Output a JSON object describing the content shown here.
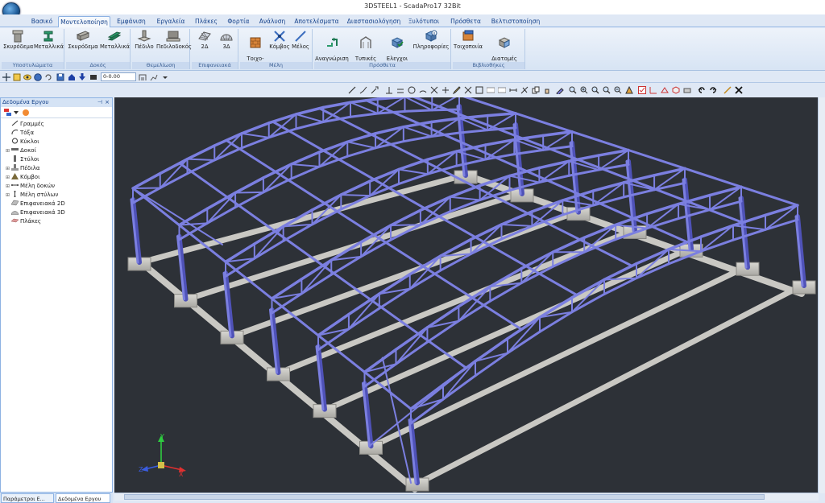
{
  "window": {
    "title": "3DSTEEL1 - ScadaPro17 32Bit"
  },
  "tabs": [
    "Βασικό",
    "Μοντελοποίηση",
    "Εμφάνιση",
    "Εργαλεία",
    "Πλάκες",
    "Φορτία",
    "Ανάλυση",
    "Αποτελέσματα",
    "Διαστασιολόγηση",
    "Ξυλότυποι",
    "Πρόσθετα",
    "Βελτιστοποίηση"
  ],
  "ribbon": {
    "groups": [
      {
        "label": "Υποστυλώματα",
        "buttons": [
          "Σκυρόδεμα",
          "Μεταλλικά"
        ]
      },
      {
        "label": "Δοκός",
        "buttons": [
          "Σκυρόδεμα",
          "Μεταλλικά"
        ]
      },
      {
        "label": "Θεμελίωση",
        "buttons": [
          "Πέδιλο",
          "Πεδιλοδοκός"
        ]
      },
      {
        "label": "Επιφανειακά",
        "buttons": [
          "2Δ",
          "3Δ"
        ]
      },
      {
        "label": "Μέλη",
        "buttons": [
          "Τοιχο-\nπλήρωση",
          "Κόμβος",
          "Μέλος"
        ]
      },
      {
        "label": "Πρόσθετα",
        "buttons": [
          "Αναγνώριση\nΔιατομών",
          "Τυπικές\nΚατασκευές",
          "Ελεγχοι\nΜοντέλου",
          "Πληροφορίες"
        ]
      },
      {
        "label": "Βιβλιοθήκες",
        "buttons": [
          "Τοιχοποιία",
          "Διατομές\nΣκυροδέματος"
        ]
      }
    ]
  },
  "qat": {
    "coordinate": "0-0.00"
  },
  "panel": {
    "title": "Δεδομένα Εργου",
    "pin": "⊣",
    "close": "×",
    "items": [
      {
        "label": "Γραμμές",
        "expand": ""
      },
      {
        "label": "Τόξα",
        "expand": ""
      },
      {
        "label": "Κύκλοι",
        "expand": ""
      },
      {
        "label": "Δοκοί",
        "expand": "⊞"
      },
      {
        "label": "Στύλοι",
        "expand": ""
      },
      {
        "label": "Πέδιλα",
        "expand": "⊞"
      },
      {
        "label": "Κόμβοι",
        "expand": "⊞"
      },
      {
        "label": "Μέλη δοκών",
        "expand": "⊞"
      },
      {
        "label": "Μέλη στύλων",
        "expand": "⊞"
      },
      {
        "label": "Επιφανειακά 2D",
        "expand": ""
      },
      {
        "label": "Επιφανειακά 3D",
        "expand": ""
      },
      {
        "label": "Πλάκες",
        "expand": ""
      }
    ]
  },
  "bottom_tabs": [
    "Παράμετροι Ε...",
    "Δεδομένα Εργου"
  ],
  "axes": {
    "x": "X",
    "y": "Y",
    "z": "Z"
  },
  "colors": {
    "steel": "#7b7fe0",
    "steel_dark": "#4f52b8",
    "concrete": "#c9c8c3",
    "background": "#2d3137",
    "accent": "#15428b"
  }
}
